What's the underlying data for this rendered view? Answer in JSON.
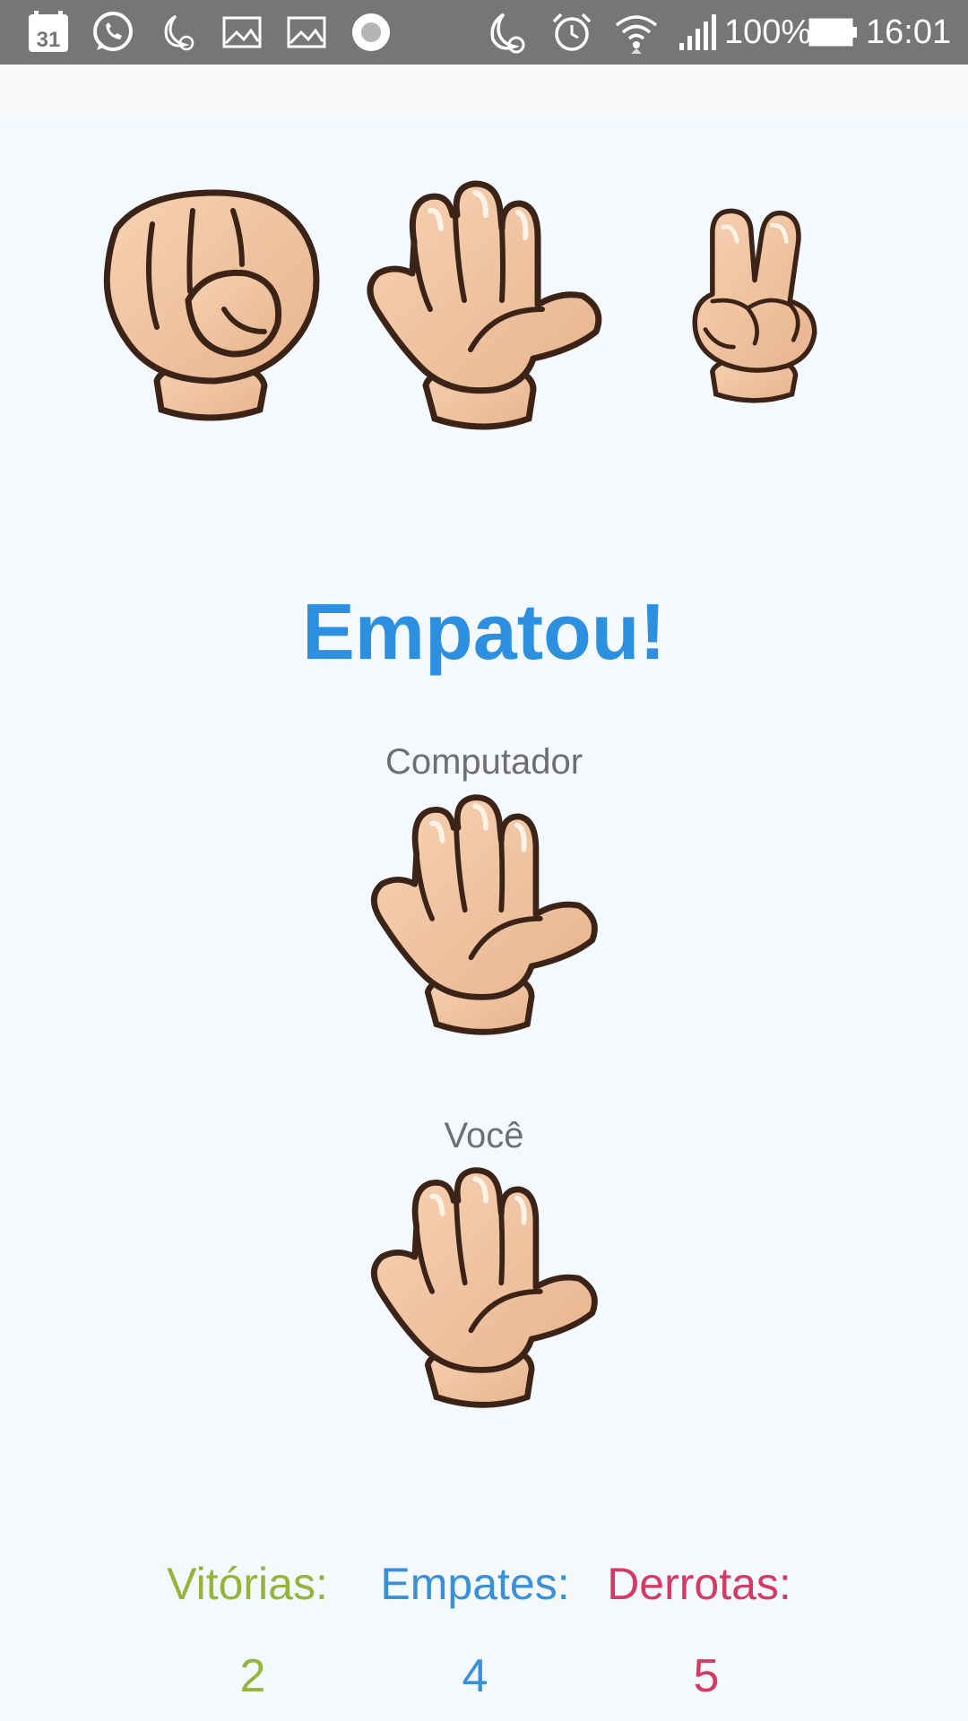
{
  "status_bar": {
    "calendar_day": "31",
    "battery": "100%",
    "time": "16:01",
    "icons": [
      "calendar-icon",
      "whatsapp-icon",
      "moon-alarm-icon",
      "image-icon",
      "image-icon",
      "record-icon",
      "moon-alarm-icon",
      "alarm-icon",
      "wifi-icon",
      "signal-icon",
      "battery-icon"
    ]
  },
  "choices": [
    {
      "name": "pedra",
      "icon": "fist-hand-icon"
    },
    {
      "name": "papel",
      "icon": "open-hand-icon"
    },
    {
      "name": "tesoura",
      "icon": "peace-hand-icon"
    }
  ],
  "result": {
    "title": "Empatou!",
    "computer_label": "Computador",
    "computer_choice_icon": "open-hand-icon",
    "player_label": "Você",
    "player_choice_icon": "open-hand-icon"
  },
  "score": {
    "wins_label": "Vitórias:",
    "ties_label": "Empates:",
    "losses_label": "Derrotas:",
    "wins": "2",
    "ties": "4",
    "losses": "5"
  },
  "colors": {
    "background": "#f3f9fd",
    "title": "#2d8fe0",
    "wins": "#95b43a",
    "ties": "#3a8fd9",
    "losses": "#d63a62",
    "statusbar": "#767676"
  }
}
